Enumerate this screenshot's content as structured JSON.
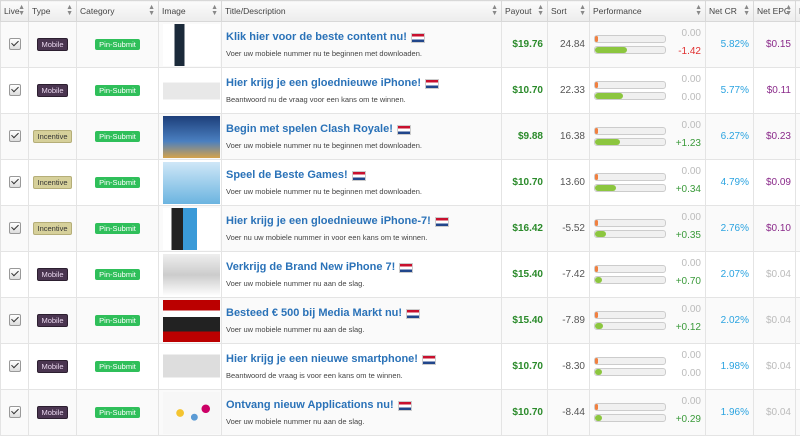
{
  "headers": {
    "live": "Live",
    "type": "Type",
    "category": "Category",
    "image": "Image",
    "title": "Title/Description",
    "payout": "Payout",
    "sort": "Sort",
    "performance": "Performance",
    "net_cr": "Net CR",
    "net_epc": "Net EPC",
    "extra": "E"
  },
  "rows": [
    {
      "type": "mobile",
      "type_label": "Mobile",
      "category": "Pin-Submit",
      "title": "Klik hier voor de beste content nu!",
      "desc": "Voer uw mobiele nummer nu te beginnen met downloaden.",
      "payout": "$19.76",
      "sort": "24.84",
      "perf_top": "0.00",
      "perf_bot": "-1.42",
      "perf_bot_fill": 0.45,
      "net_cr": "5.82%",
      "net_epc": "$0.15",
      "epc_active": true,
      "thumb": "phone"
    },
    {
      "type": "mobile",
      "type_label": "Mobile",
      "category": "Pin-Submit",
      "title": "Hier krijg je een gloednieuwe iPhone!",
      "desc": "Beantwoord nu de vraag voor een kans om te winnen.",
      "payout": "$10.70",
      "sort": "22.33",
      "perf_top": "0.00",
      "perf_bot": "0.00",
      "perf_bot_fill": 0.4,
      "net_cr": "5.77%",
      "net_epc": "$0.11",
      "epc_active": true,
      "thumb": "iphone"
    },
    {
      "type": "incentive",
      "type_label": "Incentive",
      "category": "Pin-Submit",
      "title": "Begin met spelen Clash Royale!",
      "desc": "Voer uw mobiele nummer nu te beginnen met downloaden.",
      "payout": "$9.88",
      "sort": "16.38",
      "perf_top": "0.00",
      "perf_bot": "+1.23",
      "perf_bot_fill": 0.35,
      "net_cr": "6.27%",
      "net_epc": "$0.23",
      "epc_active": true,
      "thumb": "game"
    },
    {
      "type": "incentive",
      "type_label": "Incentive",
      "category": "Pin-Submit",
      "title": "Speel de Beste Games!",
      "desc": "Voer uw mobiele nummer nu te beginnen met downloaden.",
      "payout": "$10.70",
      "sort": "13.60",
      "perf_top": "0.00",
      "perf_bot": "+0.34",
      "perf_bot_fill": 0.3,
      "net_cr": "4.79%",
      "net_epc": "$0.09",
      "epc_active": true,
      "thumb": "games"
    },
    {
      "type": "incentive",
      "type_label": "Incentive",
      "category": "Pin-Submit",
      "title": "Hier krijg je een gloednieuwe iPhone-7!",
      "desc": "Voer nu uw mobiele nummer in voor een kans om te winnen.",
      "payout": "$16.42",
      "sort": "-5.52",
      "perf_top": "0.00",
      "perf_bot": "+0.35",
      "perf_bot_fill": 0.15,
      "net_cr": "2.76%",
      "net_epc": "$0.10",
      "epc_active": true,
      "thumb": "iphone7"
    },
    {
      "type": "mobile",
      "type_label": "Mobile",
      "category": "Pin-Submit",
      "title": "Verkrijg de Brand New iPhone 7!",
      "desc": "Voer uw mobiele nummer nu aan de slag.",
      "payout": "$15.40",
      "sort": "-7.42",
      "perf_top": "0.00",
      "perf_bot": "+0.70",
      "perf_bot_fill": 0.1,
      "net_cr": "2.07%",
      "net_epc": "$0.04",
      "epc_active": false,
      "thumb": "brand"
    },
    {
      "type": "mobile",
      "type_label": "Mobile",
      "category": "Pin-Submit",
      "title": "Besteed € 500 bij Media Markt nu!",
      "desc": "Voer uw mobiele nummer nu aan de slag.",
      "payout": "$15.40",
      "sort": "-7.89",
      "perf_top": "0.00",
      "perf_bot": "+0.12",
      "perf_bot_fill": 0.12,
      "net_cr": "2.02%",
      "net_epc": "$0.04",
      "epc_active": false,
      "thumb": "mediamarkt"
    },
    {
      "type": "mobile",
      "type_label": "Mobile",
      "category": "Pin-Submit",
      "title": "Hier krijg je een nieuwe smartphone!",
      "desc": "Beantwoord de vraag is voor een kans om te winnen.",
      "payout": "$10.70",
      "sort": "-8.30",
      "perf_top": "0.00",
      "perf_bot": "0.00",
      "perf_bot_fill": 0.1,
      "net_cr": "1.98%",
      "net_epc": "$0.04",
      "epc_active": false,
      "thumb": "smartphone"
    },
    {
      "type": "mobile",
      "type_label": "Mobile",
      "category": "Pin-Submit",
      "title": "Ontvang nieuw Applications nu!",
      "desc": "Voer uw mobiele nummer nu aan de slag.",
      "payout": "$10.70",
      "sort": "-8.44",
      "perf_top": "0.00",
      "perf_bot": "+0.29",
      "perf_bot_fill": 0.1,
      "net_cr": "1.96%",
      "net_epc": "$0.04",
      "epc_active": false,
      "thumb": "apps"
    }
  ]
}
